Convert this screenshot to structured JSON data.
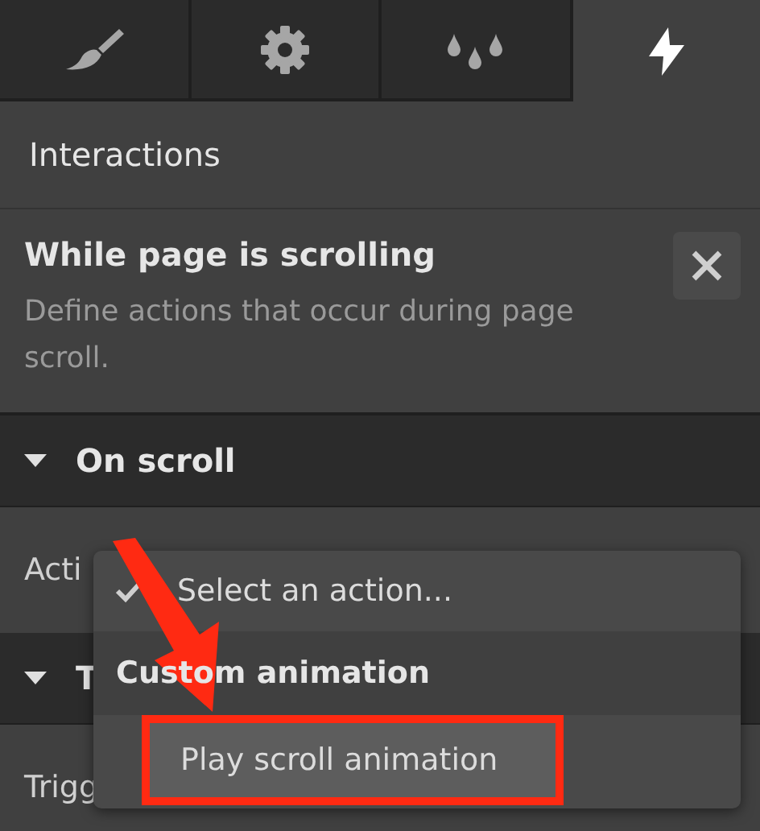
{
  "tabs": [
    {
      "kind": "brush",
      "selected": false
    },
    {
      "kind": "gear",
      "selected": false
    },
    {
      "kind": "drops",
      "selected": false
    },
    {
      "kind": "bolt",
      "selected": true
    }
  ],
  "panel_title": "Interactions",
  "trigger": {
    "title": "While page is scrolling",
    "description": "Define actions that occur during page scroll."
  },
  "sections": [
    {
      "label": "On scroll",
      "expanded": true,
      "field_label": "Acti"
    },
    {
      "label": "T",
      "expanded": true,
      "field_label": "Trigg"
    }
  ],
  "dropdown": {
    "items": [
      {
        "kind": "option",
        "label": "Select an action...",
        "checked": true,
        "selected": false,
        "boxed": false
      },
      {
        "kind": "header",
        "label": "Custom animation"
      },
      {
        "kind": "option",
        "label": "Play scroll animation",
        "checked": false,
        "selected": true,
        "boxed": true
      }
    ]
  },
  "annotation": {
    "arrow": true
  }
}
